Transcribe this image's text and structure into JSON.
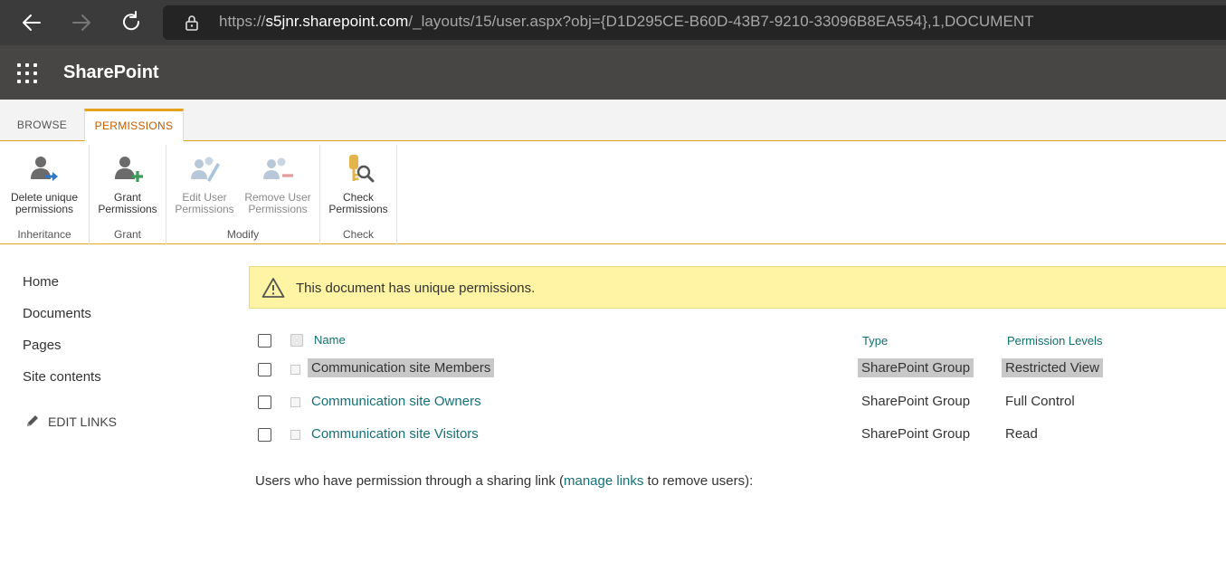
{
  "browser": {
    "url_prefix": "https://",
    "url_host": "s5jnr.sharepoint.com",
    "url_path": "/_layouts/15/user.aspx?obj={D1D295CE-B60D-43B7-9210-33096B8EA554},1,DOCUMENT"
  },
  "suite": {
    "title": "SharePoint"
  },
  "ribbon": {
    "tabs": [
      {
        "label": "BROWSE",
        "selected": false
      },
      {
        "label": "PERMISSIONS",
        "selected": true
      }
    ],
    "groups": [
      {
        "label": "Inheritance",
        "buttons": [
          {
            "line1": "Delete unique",
            "line2": "permissions",
            "enabled": true,
            "icon": "delete-inheritance-icon"
          }
        ]
      },
      {
        "label": "Grant",
        "buttons": [
          {
            "line1": "Grant",
            "line2": "Permissions",
            "enabled": true,
            "icon": "grant-permissions-icon"
          }
        ]
      },
      {
        "label": "Modify",
        "buttons": [
          {
            "line1": "Edit User",
            "line2": "Permissions",
            "enabled": false,
            "icon": "edit-user-icon"
          },
          {
            "line1": "Remove User",
            "line2": "Permissions",
            "enabled": false,
            "icon": "remove-user-icon"
          }
        ]
      },
      {
        "label": "Check",
        "buttons": [
          {
            "line1": "Check",
            "line2": "Permissions",
            "enabled": true,
            "icon": "check-permissions-icon"
          }
        ]
      }
    ]
  },
  "left_nav": {
    "items": [
      "Home",
      "Documents",
      "Pages",
      "Site contents"
    ],
    "edit_links": "EDIT LINKS"
  },
  "notice": {
    "text": "This document has unique permissions."
  },
  "table": {
    "headers": {
      "name": "Name",
      "type": "Type",
      "permission": "Permission Levels"
    },
    "rows": [
      {
        "name": "Communication site Members",
        "type": "SharePoint Group",
        "permission": "Restricted View",
        "highlighted": true
      },
      {
        "name": "Communication site Owners",
        "type": "SharePoint Group",
        "permission": "Full Control",
        "highlighted": false
      },
      {
        "name": "Communication site Visitors",
        "type": "SharePoint Group",
        "permission": "Read",
        "highlighted": false
      }
    ]
  },
  "footer": {
    "before": "Users who have permission through a sharing link (",
    "link": "manage links",
    "after": " to remove users):"
  },
  "colors": {
    "accent": "#e6a21a",
    "link": "#137177",
    "suite_bar": "#484644",
    "notice_bg": "#fff4a3"
  }
}
